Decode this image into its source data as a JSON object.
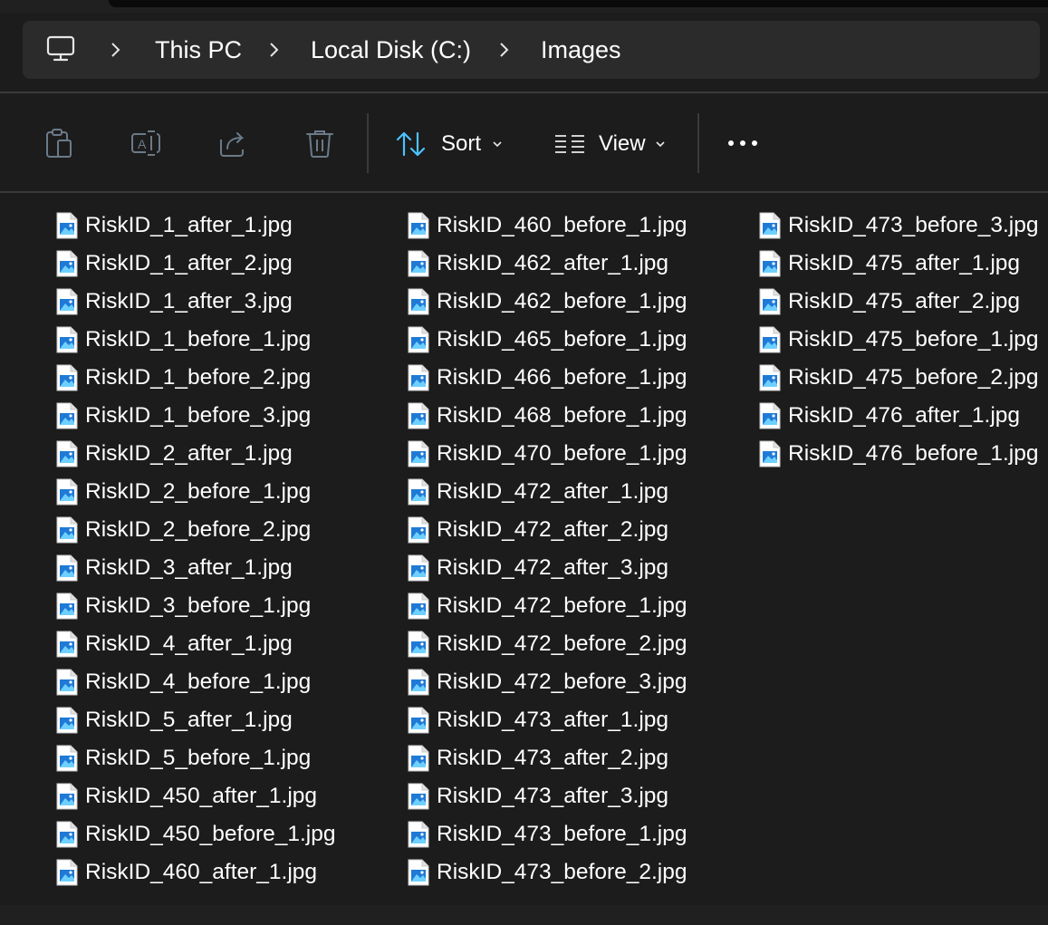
{
  "breadcrumb": {
    "items": [
      "This PC",
      "Local Disk (C:)",
      "Images"
    ]
  },
  "toolbar": {
    "copy_icon": "clipboard-icon",
    "rename_icon": "rename-icon",
    "share_icon": "share-icon",
    "delete_icon": "trash-icon",
    "sort_label": "Sort",
    "view_label": "View",
    "more_icon": "more-horizontal-icon"
  },
  "colors": {
    "background": "#1c1c1c",
    "addressbar": "#2b2b2b",
    "accent": "#4cc2ff",
    "disabled_icon": "#6b7a88"
  },
  "files": {
    "col1": [
      "RiskID_1_after_1.jpg",
      "RiskID_1_after_2.jpg",
      "RiskID_1_after_3.jpg",
      "RiskID_1_before_1.jpg",
      "RiskID_1_before_2.jpg",
      "RiskID_1_before_3.jpg",
      "RiskID_2_after_1.jpg",
      "RiskID_2_before_1.jpg",
      "RiskID_2_before_2.jpg",
      "RiskID_3_after_1.jpg",
      "RiskID_3_before_1.jpg",
      "RiskID_4_after_1.jpg",
      "RiskID_4_before_1.jpg",
      "RiskID_5_after_1.jpg",
      "RiskID_5_before_1.jpg",
      "RiskID_450_after_1.jpg",
      "RiskID_450_before_1.jpg",
      "RiskID_460_after_1.jpg"
    ],
    "col2": [
      "RiskID_460_before_1.jpg",
      "RiskID_462_after_1.jpg",
      "RiskID_462_before_1.jpg",
      "RiskID_465_before_1.jpg",
      "RiskID_466_before_1.jpg",
      "RiskID_468_before_1.jpg",
      "RiskID_470_before_1.jpg",
      "RiskID_472_after_1.jpg",
      "RiskID_472_after_2.jpg",
      "RiskID_472_after_3.jpg",
      "RiskID_472_before_1.jpg",
      "RiskID_472_before_2.jpg",
      "RiskID_472_before_3.jpg",
      "RiskID_473_after_1.jpg",
      "RiskID_473_after_2.jpg",
      "RiskID_473_after_3.jpg",
      "RiskID_473_before_1.jpg",
      "RiskID_473_before_2.jpg"
    ],
    "col3": [
      "RiskID_473_before_3.jpg",
      "RiskID_475_after_1.jpg",
      "RiskID_475_after_2.jpg",
      "RiskID_475_before_1.jpg",
      "RiskID_475_before_2.jpg",
      "RiskID_476_after_1.jpg",
      "RiskID_476_before_1.jpg"
    ]
  }
}
